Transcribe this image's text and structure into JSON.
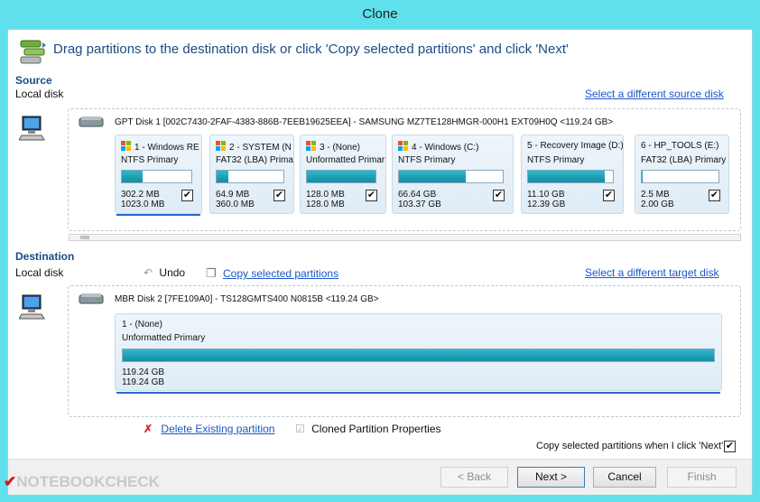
{
  "window": {
    "title": "Clone"
  },
  "header": {
    "instruction": "Drag partitions to the destination disk or click 'Copy selected partitions' and click 'Next'"
  },
  "source": {
    "title": "Source",
    "subtitle": "Local disk",
    "change_link": "Select a different source disk",
    "disk_label": "GPT Disk 1 [002C7430-2FAF-4383-886B-7EEB19625EEA] - SAMSUNG MZ7TE128HMGR-000H1 EXT09H0Q  <119.24 GB>",
    "disk_checked": true,
    "partitions": [
      {
        "name": "1 - Windows RE",
        "type": "NTFS Primary",
        "used": "302.2 MB",
        "total": "1023.0 MB",
        "fill": 0.3,
        "checked": true,
        "win_icon": true
      },
      {
        "name": "2 - SYSTEM (N",
        "type": "FAT32 (LBA) Prima",
        "used": "64.9 MB",
        "total": "360.0 MB",
        "fill": 0.18,
        "checked": true,
        "win_icon": true
      },
      {
        "name": "3 -  (None)",
        "type": "Unformatted Primar",
        "used": "128.0 MB",
        "total": "128.0 MB",
        "fill": 1.0,
        "checked": true,
        "win_icon": true
      },
      {
        "name": "4 - Windows (C:)",
        "type": "NTFS Primary",
        "used": "66.64 GB",
        "total": "103.37 GB",
        "fill": 0.64,
        "checked": true,
        "win_icon": true
      },
      {
        "name": "5 - Recovery Image (D:)",
        "type": "NTFS Primary",
        "used": "11.10 GB",
        "total": "12.39 GB",
        "fill": 0.9,
        "checked": true,
        "win_icon": false
      },
      {
        "name": "6 - HP_TOOLS (E:)",
        "type": "FAT32 (LBA) Primary",
        "used": "2.5 MB",
        "total": "2.00 GB",
        "fill": 0.01,
        "checked": true,
        "win_icon": false
      }
    ]
  },
  "destination": {
    "title": "Destination",
    "subtitle": "Local disk",
    "undo_label": "Undo",
    "copy_link": "Copy selected partitions",
    "change_link": "Select a different target disk",
    "disk_label": "MBR Disk 2 [7FE109A0] - TS128GMTS400 N0815B  <119.24 GB>",
    "partition": {
      "name": "1 -  (None)",
      "type": "Unformatted Primary",
      "used": "119.24 GB",
      "total": "119.24 GB",
      "fill": 1.0
    },
    "delete_link": "Delete Existing partition",
    "properties_label": "Cloned Partition Properties"
  },
  "options": {
    "copy_on_next_label": "Copy selected partitions when I click 'Next'",
    "copy_on_next_checked": true
  },
  "buttons": {
    "back": "< Back",
    "next": "Next >",
    "cancel": "Cancel",
    "finish": "Finish"
  },
  "watermark": "NOTEBOOKCHECK"
}
